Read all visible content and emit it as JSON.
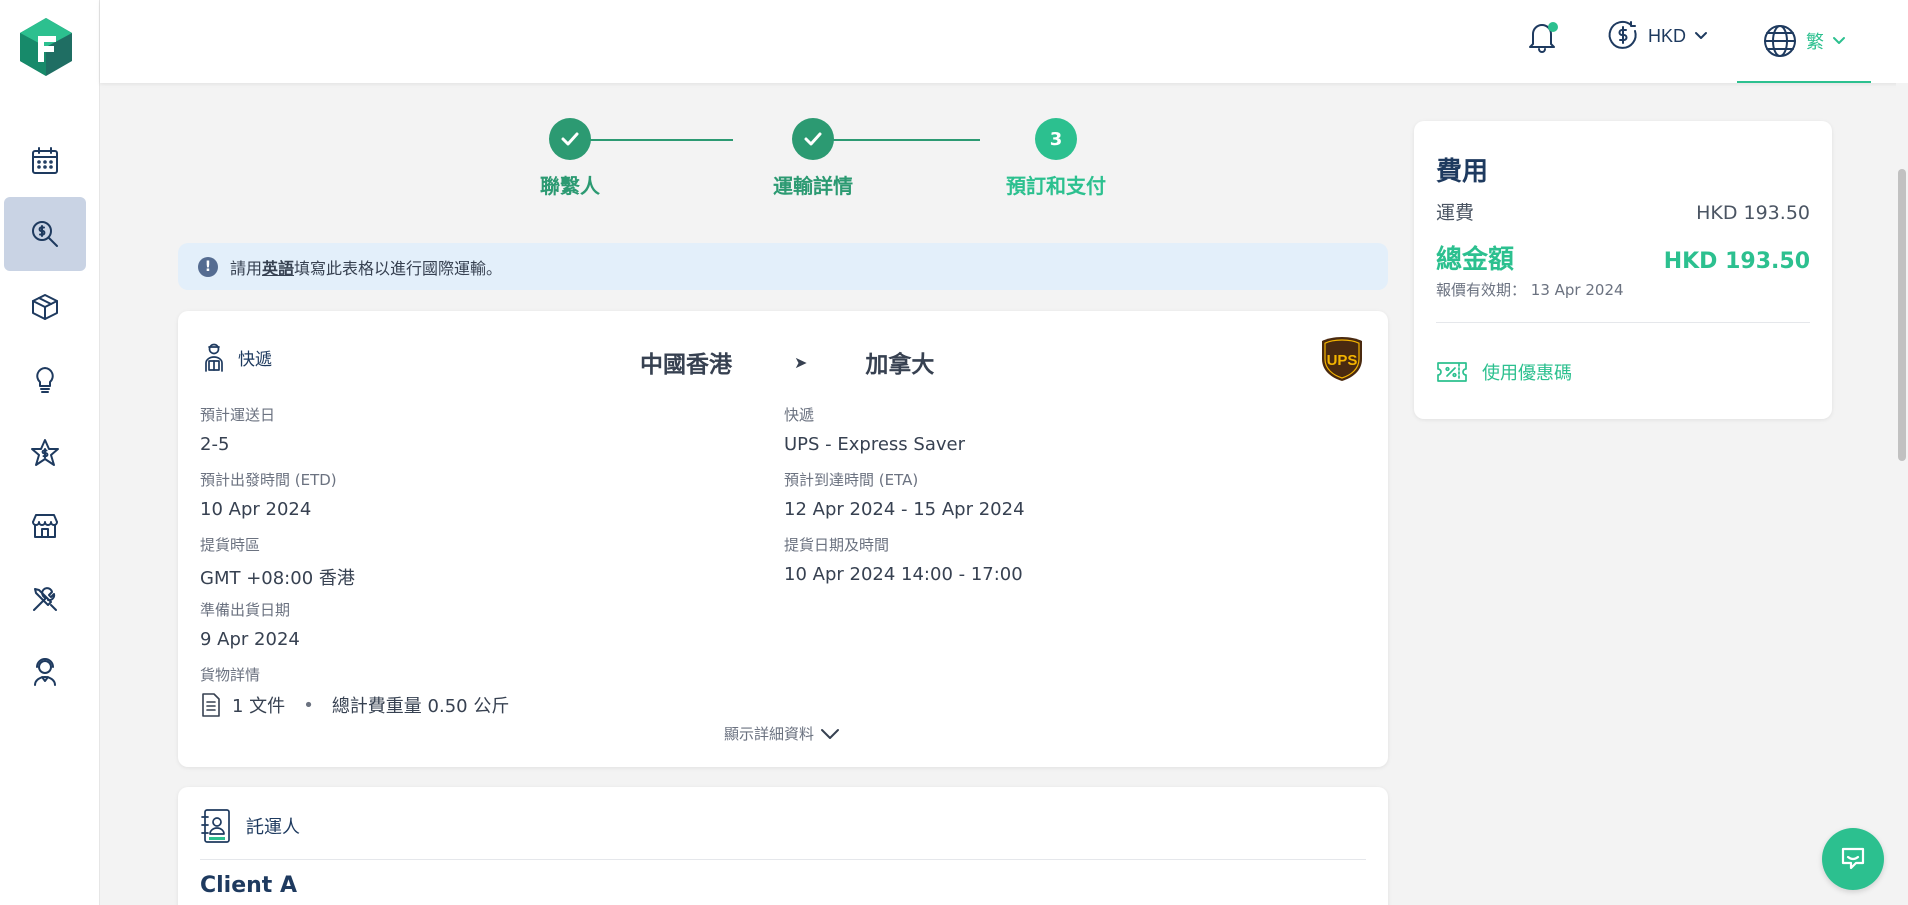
{
  "header": {
    "currency": "HKD",
    "language": "繁"
  },
  "sidebar": {
    "items": [
      {
        "icon": "calendar-icon"
      },
      {
        "icon": "quote-search-icon",
        "active": true
      },
      {
        "icon": "package-icon"
      },
      {
        "icon": "lightbulb-icon"
      },
      {
        "icon": "star-dollar-icon"
      },
      {
        "icon": "store-icon"
      },
      {
        "icon": "tools-icon"
      },
      {
        "icon": "support-agent-icon"
      }
    ]
  },
  "stepper": {
    "steps": [
      {
        "label": "聯繫人",
        "status": "done"
      },
      {
        "label": "運輸詳情",
        "status": "done"
      },
      {
        "label": "預訂和支付",
        "number": "3",
        "status": "current"
      }
    ]
  },
  "notice": {
    "prefix": "請用",
    "emphasis": "英語",
    "suffix": "填寫此表格以進行國際運輸。"
  },
  "shipment": {
    "type": "快遞",
    "origin": "中國香港",
    "arrow": "➤",
    "destination": "加拿大",
    "carrier_logo": "UPS",
    "fields": {
      "estimated_days": {
        "label": "預計運送日",
        "value": "2-5"
      },
      "courier": {
        "label": "快遞",
        "value": "UPS - Express Saver"
      },
      "etd": {
        "label": "預計出發時間 (ETD)",
        "value": "10 Apr 2024"
      },
      "eta": {
        "label": "預計到達時間 (ETA)",
        "value": "12 Apr 2024 - 15 Apr 2024"
      },
      "pickup_timezone": {
        "label": "提貨時區",
        "value": "GMT +08:00 香港"
      },
      "pickup_datetime": {
        "label": "提貨日期及時間",
        "value": "10 Apr 2024 14:00 - 17:00"
      },
      "ready_date": {
        "label": "準備出貨日期",
        "value": "9 Apr 2024"
      },
      "goods": {
        "label": "貨物詳情"
      }
    },
    "goods_summary": {
      "count": "1 文件",
      "separator": "•",
      "weight": "總計費重量 0.50 公斤"
    },
    "show_details": "顯示詳細資料"
  },
  "shipper": {
    "title": "託運人",
    "name": "Client A"
  },
  "cost": {
    "title": "費用",
    "fee_label": "運費",
    "fee_value": "HKD 193.50",
    "total_label": "總金額",
    "total_value": "HKD 193.50",
    "validity_label": "報價有效期：",
    "validity_date": "13 Apr 2024",
    "coupon": "使用優惠碼"
  },
  "colors": {
    "brand_green": "#2cc08f",
    "step_green": "#2c9a72",
    "navy": "#1e3a5f",
    "notice_bg": "#e3effa"
  }
}
